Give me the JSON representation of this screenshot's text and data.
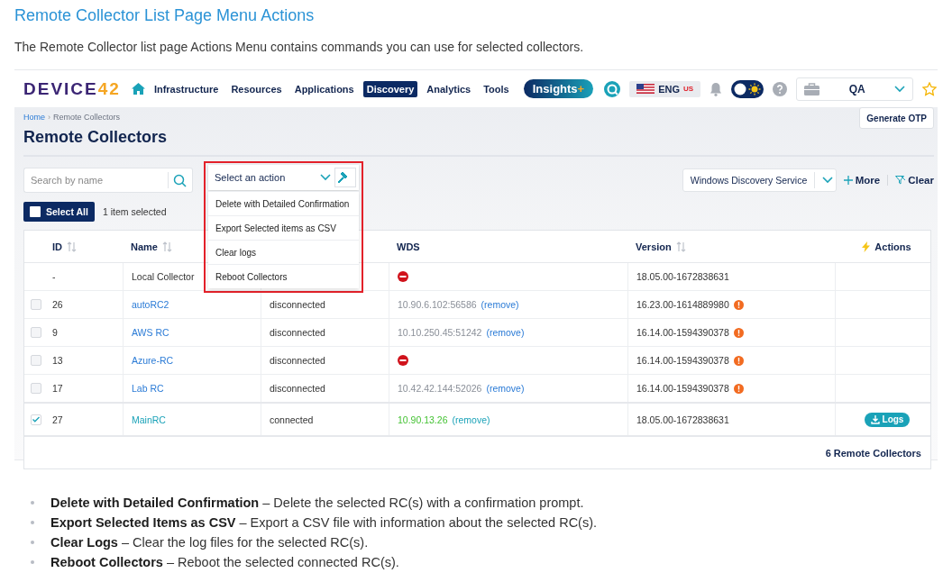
{
  "doc": {
    "heading": "Remote Collector List Page Menu Actions",
    "intro": "The Remote Collector list page Actions Menu contains commands you can use for selected collectors."
  },
  "navbar": {
    "logo": {
      "text": "DEVICE",
      "number": "42"
    },
    "items": [
      {
        "label": "Infrastructure",
        "selected": false
      },
      {
        "label": "Resources",
        "selected": false
      },
      {
        "label": "Applications",
        "selected": false
      },
      {
        "label": "Discovery",
        "selected": true
      },
      {
        "label": "Analytics",
        "selected": false
      },
      {
        "label": "Tools",
        "selected": false
      }
    ],
    "insights": {
      "label": "Insights",
      "suffix": "+"
    },
    "language": {
      "code": "ENG",
      "region": "US"
    },
    "workspace": "QA"
  },
  "page": {
    "breadcrumb": [
      {
        "label": "Home",
        "kind": "link"
      },
      {
        "label": "Remote Collectors",
        "kind": "current"
      }
    ],
    "breadcrumb_separator": "›",
    "title": "Remote Collectors",
    "generate_button": "Generate OTP",
    "search": {
      "placeholder": "Search by name"
    },
    "select_all": {
      "label": "Select All",
      "checked": false
    },
    "selection_count": "1 item selected",
    "filter": {
      "value": "Windows Discovery Service"
    },
    "more": "More",
    "clear": "Clear",
    "action_menu": {
      "placeholder": "Select an action",
      "options": [
        "Delete with Detailed Confirmation",
        "Export Selected items as CSV",
        "Clear logs",
        "Reboot Collectors"
      ]
    },
    "table": {
      "columns": [
        {
          "label": "ID",
          "sortable": true
        },
        {
          "label": "Name",
          "sortable": true
        },
        {
          "label": "WDS",
          "sortable": false
        },
        {
          "label": "Version",
          "sortable": true
        },
        {
          "label": "Actions",
          "sortable": false
        }
      ],
      "rows": [
        {
          "kind": "local",
          "id": "-",
          "name": "Local Collector",
          "wds": {
            "kind": "blocked"
          },
          "version": "18.05.00-1672838631",
          "outdated": false
        },
        {
          "kind": "remote",
          "checked": false,
          "connected": false,
          "id": "26",
          "name": "autoRC2",
          "status": "disconnected",
          "wds": {
            "kind": "address",
            "address": "10.90.6.102:56586",
            "remove": "(remove)"
          },
          "version": "16.23.00-1614889980",
          "outdated": true
        },
        {
          "kind": "remote",
          "checked": false,
          "connected": false,
          "id": "9",
          "name": "AWS RC",
          "status": "disconnected",
          "wds": {
            "kind": "address",
            "address": "10.10.250.45:51242",
            "remove": "(remove)"
          },
          "version": "16.14.00-1594390378",
          "outdated": true
        },
        {
          "kind": "remote",
          "checked": false,
          "connected": false,
          "id": "13",
          "name": "Azure-RC",
          "status": "disconnected",
          "wds": {
            "kind": "blocked"
          },
          "version": "16.14.00-1594390378",
          "outdated": true
        },
        {
          "kind": "remote",
          "checked": false,
          "connected": false,
          "id": "17",
          "name": "Lab RC",
          "status": "disconnected",
          "wds": {
            "kind": "address",
            "address": "10.42.42.144:52026",
            "remove": "(remove)"
          },
          "version": "16.14.00-1594390378",
          "outdated": true
        },
        {
          "kind": "remote",
          "checked": true,
          "connected": true,
          "id": "27",
          "name": "MainRC",
          "status": "connected",
          "wds": {
            "kind": "address",
            "address": "10.90.13.26",
            "remove": "(remove)"
          },
          "version": "18.05.00-1672838631",
          "outdated": false,
          "action": "Logs"
        }
      ],
      "footer": "6 Remote Collectors"
    }
  },
  "notes": [
    "**Delete with Detailed Confirmation** – Delete the selected RC(s) with a confirmation prompt.",
    "**Export Selected Items as CSV** – Export a CSV file with information about the selected RC(s).",
    "**Clear Logs** – Clear the log files for the selected RC(s).",
    "**Reboot Collectors** – Reboot the selected connected RC(s)."
  ]
}
